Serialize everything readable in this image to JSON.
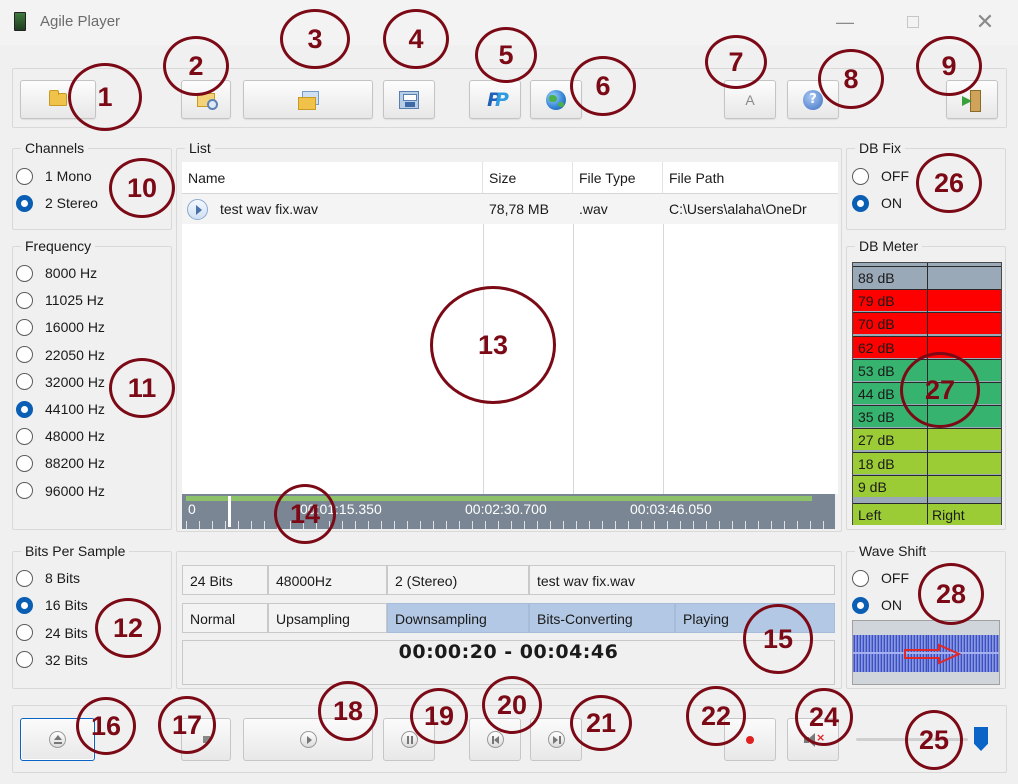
{
  "window": {
    "title": "Agile Player",
    "minimize": "—",
    "close": "✕"
  },
  "panels": {
    "channels": "Channels",
    "frequency": "Frequency",
    "bits": "Bits Per Sample",
    "list": "List",
    "db_fix": "DB Fix",
    "db_meter": "DB Meter",
    "wave_shift": "Wave Shift"
  },
  "channels": [
    "1 Mono",
    "2 Stereo"
  ],
  "frequency": [
    "8000 Hz",
    "11025 Hz",
    "16000 Hz",
    "22050 Hz",
    "32000 Hz",
    "44100 Hz",
    "48000 Hz",
    "88200 Hz",
    "96000 Hz"
  ],
  "bits": [
    "8 Bits",
    "16 Bits",
    "24 Bits",
    "32 Bits"
  ],
  "db_fix": [
    "OFF",
    "ON"
  ],
  "wave_shift": [
    "OFF",
    "ON"
  ],
  "list": {
    "columns": [
      "Name",
      "Size",
      "File Type",
      "File Path"
    ],
    "rows": [
      {
        "name": "test wav fix.wav",
        "size": "78,78 MB",
        "type": ".wav",
        "path": "C:\\Users\\alaha\\OneDr"
      }
    ]
  },
  "timeline": {
    "labels": [
      "0",
      "00:01:15.350",
      "00:02:30.700",
      "00:03:46.050"
    ]
  },
  "info": {
    "row1": [
      "24 Bits",
      "48000Hz",
      "2 (Stereo)",
      "test wav fix.wav"
    ],
    "row2": [
      "Normal",
      "Upsampling",
      "Downsampling",
      "Bits-Converting",
      "Playing"
    ],
    "time": "00:00:20 - 00:04:46"
  },
  "db_meter": {
    "levels": [
      "88 dB",
      "79 dB",
      "70 dB",
      "62 dB",
      "53 dB",
      "44 dB",
      "35 dB",
      "27 dB",
      "18 dB",
      "9 dB"
    ],
    "footer_left": "Left",
    "footer_right": "Right",
    "colors": {
      "top": "#9aa9b8",
      "red": "#ff0000",
      "green": "#36b36e",
      "yellow": "#9ccc35"
    }
  },
  "toolbar": {
    "font_button": "A",
    "help_button": "?"
  },
  "selected": {
    "channel": 1,
    "frequency": 5,
    "bits": 1,
    "db_fix": 1,
    "wave_shift": 1
  },
  "markers": [
    "1",
    "2",
    "3",
    "4",
    "5",
    "6",
    "7",
    "8",
    "9",
    "10",
    "11",
    "12",
    "13",
    "14",
    "15",
    "16",
    "17",
    "18",
    "19",
    "20",
    "21",
    "22",
    "24",
    "25",
    "26",
    "27",
    "28"
  ],
  "icons": {
    "toolbar": [
      "folder-open-icon",
      "folder-search-icon",
      "folders-icon",
      "save-icon",
      "paypal-icon",
      "globe-icon",
      "font-icon",
      "help-icon",
      "exit-icon"
    ],
    "transport": [
      "eject-icon",
      "stop-icon",
      "play-icon",
      "pause-icon",
      "previous-icon",
      "next-icon",
      "record-icon",
      "mute-icon"
    ]
  },
  "volume": {
    "level_fraction": 1.0
  }
}
